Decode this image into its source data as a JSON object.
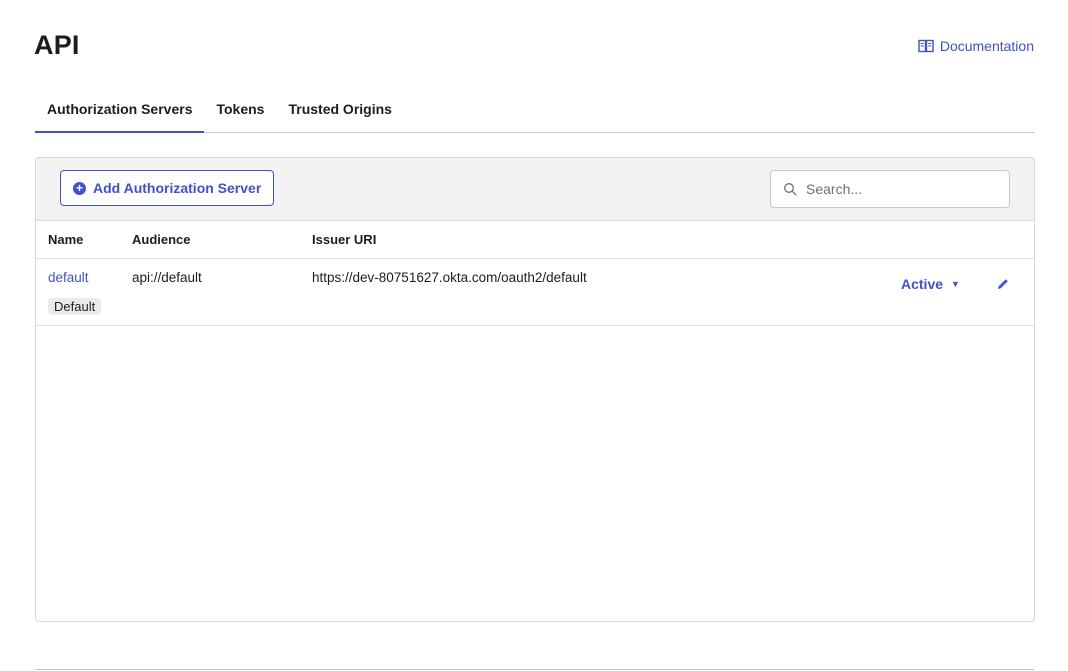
{
  "page": {
    "title": "API",
    "documentation_link": "Documentation",
    "documentation_icon": "book-icon"
  },
  "tabs": [
    {
      "label": "Authorization Servers",
      "active": true
    },
    {
      "label": "Tokens",
      "active": false
    },
    {
      "label": "Trusted Origins",
      "active": false
    }
  ],
  "toolbar": {
    "add_label": "Add Authorization Server",
    "add_icon": "plus-circle-icon",
    "search_placeholder": "Search...",
    "search_icon": "search-icon"
  },
  "table": {
    "headers": {
      "name": "Name",
      "audience": "Audience",
      "issuer": "Issuer URI"
    },
    "rows": [
      {
        "name": "default",
        "badge": "Default",
        "audience": "api://default",
        "issuer": "https://dev-80751627.okta.com/oauth2/default",
        "status": "Active",
        "status_icon": "caret-down-icon",
        "edit_icon": "pencil-icon"
      }
    ]
  },
  "colors": {
    "accent": "#3f52c8",
    "text": "#1d1d21",
    "toolbar_bg": "#f2f2f3",
    "border": "#d7d7dc"
  }
}
